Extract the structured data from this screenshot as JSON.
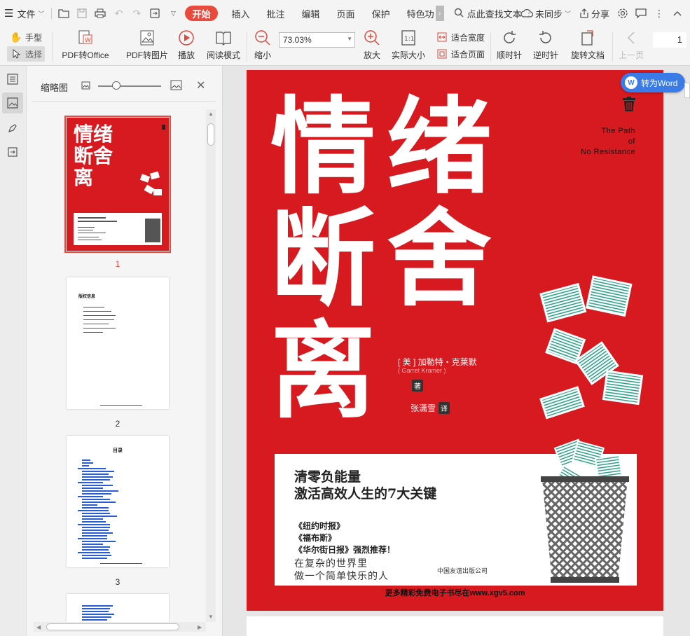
{
  "menubar": {
    "file_label": "文件",
    "tabs": [
      "开始",
      "插入",
      "批注",
      "编辑",
      "页面",
      "保护",
      "特色功"
    ],
    "search_label": "点此查找文本",
    "sync_label": "未同步",
    "share_label": "分享"
  },
  "ribbon": {
    "hand_tool": "手型",
    "select_tool": "选择",
    "pdf_to_office": "PDF转Office",
    "pdf_to_image": "PDF转图片",
    "play": "播放",
    "read_mode": "阅读模式",
    "zoom_out": "缩小",
    "zoom_value": "73.03%",
    "zoom_in": "放大",
    "actual_size": "实际大小",
    "fit_width": "适合宽度",
    "fit_page": "适合页面",
    "rotate_cw": "顺时针",
    "rotate_ccw": "逆时针",
    "rotate_doc": "旋转文档",
    "prev_page": "上一页",
    "page_number": "1"
  },
  "thumbnail_panel": {
    "title": "缩略图",
    "pages": [
      "1",
      "2",
      "3"
    ],
    "thumb1_lines": [
      "情绪",
      "断舍",
      "离"
    ],
    "thumb2_title": "版权信息",
    "thumb3_title": "目录"
  },
  "cover": {
    "title_chars": [
      "情",
      "绪",
      "断",
      "舍",
      "离"
    ],
    "english_title": [
      "The Path",
      "of",
      "No Resistance"
    ],
    "author": "[ 美 ] 加勒特・克莱默",
    "author_en": "( Garret Kramer )",
    "author_role": "著",
    "translator": "张潇雪",
    "translator_role": "译",
    "slogan_1": "清零负能量",
    "slogan_2": "激活高效人生的7大关键",
    "recommendations": [
      "《纽约时报》",
      "《福布斯》",
      "《华尔街日报》强烈推荐！"
    ],
    "tagline_1": "在复杂的世界里",
    "tagline_2": "做一个简单快乐的人",
    "publisher": "中国友谊出版公司",
    "footer_ad": "更多精彩免费电子书尽在www.xgv5.com"
  },
  "to_word_button": "转为Word",
  "colors": {
    "accent": "#e84a3e",
    "cover_red": "#d71920",
    "to_word_blue": "#3a7be8"
  }
}
